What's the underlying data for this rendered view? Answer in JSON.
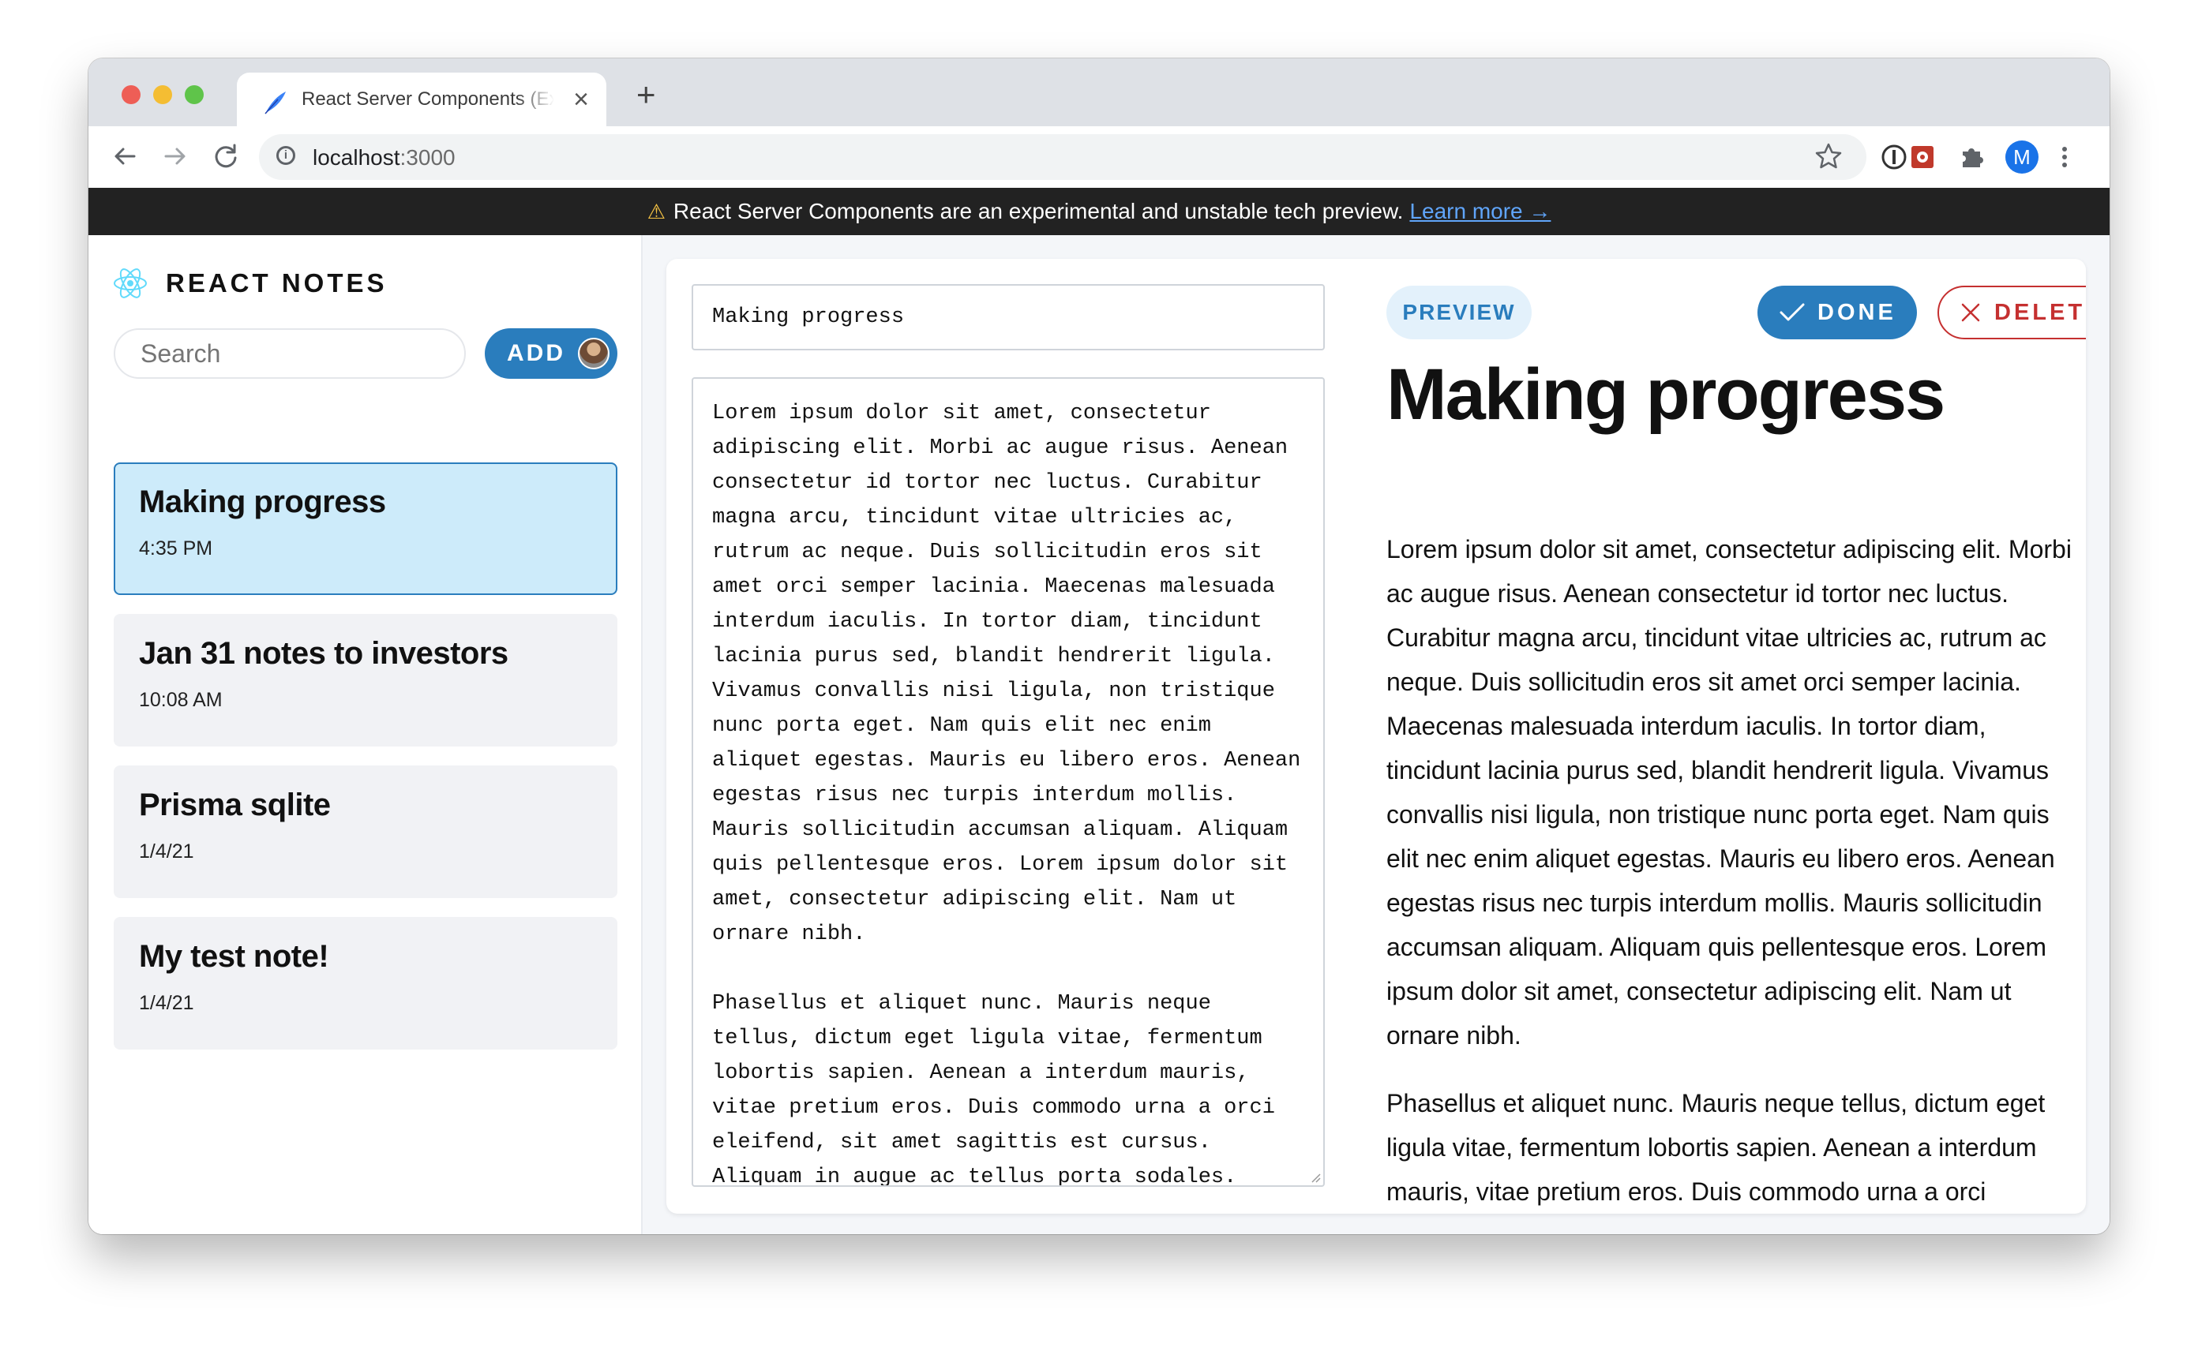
{
  "browser": {
    "tab_title": "React Server Components (Experimental Demo)",
    "tab_close": "×",
    "new_tab": "+",
    "url_host": "localhost",
    "url_port": ":3000",
    "avatar_letter": "M"
  },
  "banner": {
    "text": "React Server Components are an experimental and unstable tech preview.",
    "link": "Learn more →",
    "icon": "warning-icon"
  },
  "sidebar": {
    "brand": "REACT NOTES",
    "search_placeholder": "Search",
    "add_label": "ADD",
    "notes": [
      {
        "title": "Making progress",
        "date": "4:35 PM",
        "active": true
      },
      {
        "title": "Jan 31 notes to investors",
        "date": "10:08 AM",
        "active": false
      },
      {
        "title": "Prisma sqlite",
        "date": "1/4/21",
        "active": false
      },
      {
        "title": "My test note!",
        "date": "1/4/21",
        "active": false
      }
    ]
  },
  "editor": {
    "title_value": "Making progress",
    "body_value": "Lorem ipsum dolor sit amet, consectetur adipiscing elit. Morbi ac augue risus. Aenean consectetur id tortor nec luctus. Curabitur magna arcu, tincidunt vitae ultricies ac, rutrum ac neque. Duis sollicitudin eros sit amet orci semper lacinia. Maecenas malesuada interdum iaculis. In tortor diam, tincidunt lacinia purus sed, blandit hendrerit ligula. Vivamus convallis nisi ligula, non tristique nunc porta eget. Nam quis elit nec enim aliquet egestas. Mauris eu libero eros. Aenean egestas risus nec turpis interdum mollis. Mauris sollicitudin accumsan aliquam. Aliquam quis pellentesque eros. Lorem ipsum dolor sit amet, consectetur adipiscing elit. Nam ut ornare nibh.\n\nPhasellus et aliquet nunc. Mauris neque tellus, dictum eget ligula vitae, fermentum lobortis sapien. Aenean a interdum mauris, vitae pretium eros. Duis commodo urna a orci eleifend, sit amet sagittis est cursus. Aliquam in augue ac tellus porta sodales. Fusce non laoreet nunc, in placerat enim. Mauris ut magna porta, lobortis"
  },
  "preview": {
    "label": "PREVIEW",
    "done_label": "DONE",
    "delete_label": "DELETE",
    "title": "Making progress",
    "paragraphs": [
      "Lorem ipsum dolor sit amet, consectetur adipiscing elit. Morbi ac augue risus. Aenean consectetur id tortor nec luctus. Curabitur magna arcu, tincidunt vitae ultricies ac, rutrum ac neque. Duis sollicitudin eros sit amet orci semper lacinia. Maecenas malesuada interdum iaculis. In tortor diam, tincidunt lacinia purus sed, blandit hendrerit ligula. Vivamus convallis nisi ligula, non tristique nunc porta eget. Nam quis elit nec enim aliquet egestas. Mauris eu libero eros. Aenean egestas risus nec turpis interdum mollis. Mauris sollicitudin accumsan aliquam. Aliquam quis pellentesque eros. Lorem ipsum dolor sit amet, consectetur adipiscing elit. Nam ut ornare nibh.",
      "Phasellus et aliquet nunc. Mauris neque tellus, dictum eget ligula vitae, fermentum lobortis sapien. Aenean a interdum mauris, vitae pretium eros. Duis commodo urna a orci"
    ]
  },
  "colors": {
    "accent": "#2a7dbd",
    "active_note_bg": "#cdebfa",
    "danger": "#c53030",
    "banner_bg": "#222222",
    "banner_link": "#60a5fa"
  }
}
